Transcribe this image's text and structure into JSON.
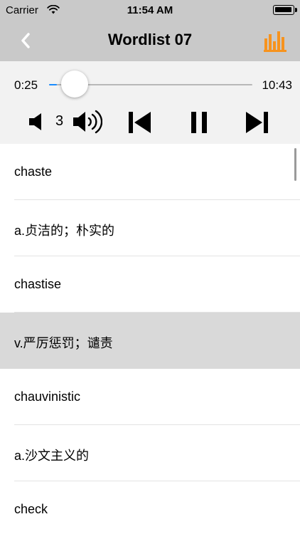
{
  "status_bar": {
    "carrier": "Carrier",
    "time": "11:54 AM"
  },
  "nav": {
    "title": "Wordlist 07"
  },
  "player": {
    "elapsed": "0:25",
    "duration": "10:43",
    "progress_fraction": 0.04,
    "volume_level": "3"
  },
  "colors": {
    "accent": "#f7931e",
    "progress": "#1a8cff",
    "header_bg": "#c9c9c9",
    "selected_row_bg": "#d9d9d9"
  },
  "icons": {
    "back": "chevron-left-icon",
    "equalizer": "equalizer-icon",
    "volume_down": "speaker-low-icon",
    "volume_up": "speaker-high-icon",
    "previous": "skip-previous-icon",
    "pause": "pause-icon",
    "next": "skip-next-icon"
  },
  "words": [
    {
      "text": "chaste",
      "selected": false
    },
    {
      "text": "a.贞洁的；朴实的",
      "selected": false
    },
    {
      "text": "chastise",
      "selected": false
    },
    {
      "text": "v.严厉惩罚；谴责",
      "selected": true
    },
    {
      "text": "chauvinistic",
      "selected": false
    },
    {
      "text": "a.沙文主义的",
      "selected": false
    },
    {
      "text": "check",
      "selected": false
    }
  ]
}
